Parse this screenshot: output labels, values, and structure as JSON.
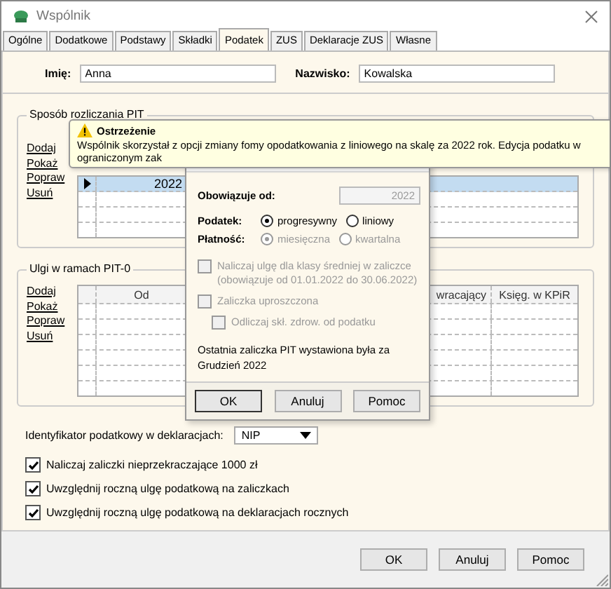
{
  "window": {
    "title": "Wspólnik"
  },
  "tabs": [
    {
      "label": "Ogólne",
      "selected": false
    },
    {
      "label": "Dodatkowe",
      "selected": false
    },
    {
      "label": "Podstawy",
      "selected": false
    },
    {
      "label": "Składki",
      "selected": false
    },
    {
      "label": "Podatek",
      "selected": true
    },
    {
      "label": "ZUS",
      "selected": false
    },
    {
      "label": "Deklaracje ZUS",
      "selected": false
    },
    {
      "label": "Własne",
      "selected": false
    }
  ],
  "name_fields": [
    {
      "label": "Imię:",
      "value": "Anna"
    },
    {
      "label": "Nazwisko:",
      "value": "Kowalska"
    }
  ],
  "pit_group": {
    "title": "Sposób rozliczania PIT",
    "actions": [
      "Dodaj",
      "Pokaż",
      "Popraw",
      "Usuń"
    ],
    "rows": [
      {
        "selected": true,
        "year": "2022"
      },
      {
        "selected": false
      },
      {
        "selected": false
      },
      {
        "selected": false
      }
    ]
  },
  "relief_group": {
    "title": "Ulgi w ramach PIT-0",
    "actions": [
      "Dodaj",
      "Pokaż",
      "Popraw",
      "Usuń"
    ],
    "columns": [
      {
        "label": "Od"
      },
      {
        "label": "wracający"
      },
      {
        "label": "Księg. w KPiR"
      }
    ]
  },
  "tax_id": {
    "label": "Identyfikator podatkowy w deklaracjach:",
    "value": "NIP"
  },
  "options": [
    {
      "label": "Naliczaj zaliczki nieprzekraczające 1000 zł",
      "checked": true
    },
    {
      "label": "Uwzględnij roczną ulgę podatkową na zaliczkach",
      "checked": true
    },
    {
      "label": "Uwzględnij roczną ulgę podatkową na deklaracjach rocznych",
      "checked": true
    }
  ],
  "buttons": [
    "OK",
    "Anuluj",
    "Pomoc"
  ],
  "warning": {
    "title": "Ostrzeżenie",
    "text": "Wspólnik skorzystał z opcji zmiany fomy opodatkowania z liniowego na skalę za 2022 rok. Edycja podatku w ograniczonym zak"
  },
  "tax_dialog": {
    "valid_from": {
      "label": "Obowiązuje od:",
      "value": "2022",
      "disabled": true
    },
    "radio_groups": [
      {
        "label": "Podatek:",
        "disabled": false,
        "options": [
          {
            "label": "progresywny",
            "selected": true
          },
          {
            "label": "liniowy",
            "selected": false
          }
        ]
      },
      {
        "label": "Płatność:",
        "disabled": true,
        "options": [
          {
            "label": "miesięczna",
            "selected": true
          },
          {
            "label": "kwartalna",
            "selected": false
          }
        ]
      }
    ],
    "checks": [
      {
        "label": "Naliczaj ulgę dla klasy średniej w zaliczce (obowiązuje od 01.01.2022 do 30.06.2022)",
        "checked": false,
        "disabled": true,
        "indented": false
      },
      {
        "label": "Zaliczka uproszczona",
        "checked": false,
        "disabled": true,
        "indented": false
      },
      {
        "label": "Odliczaj skł. zdrow. od podatku",
        "checked": false,
        "disabled": true,
        "indented": true
      }
    ],
    "note": "Ostatnia zaliczka PIT wystawiona była za Grudzień 2022",
    "buttons": [
      "OK",
      "Anuluj",
      "Pomoc"
    ]
  }
}
